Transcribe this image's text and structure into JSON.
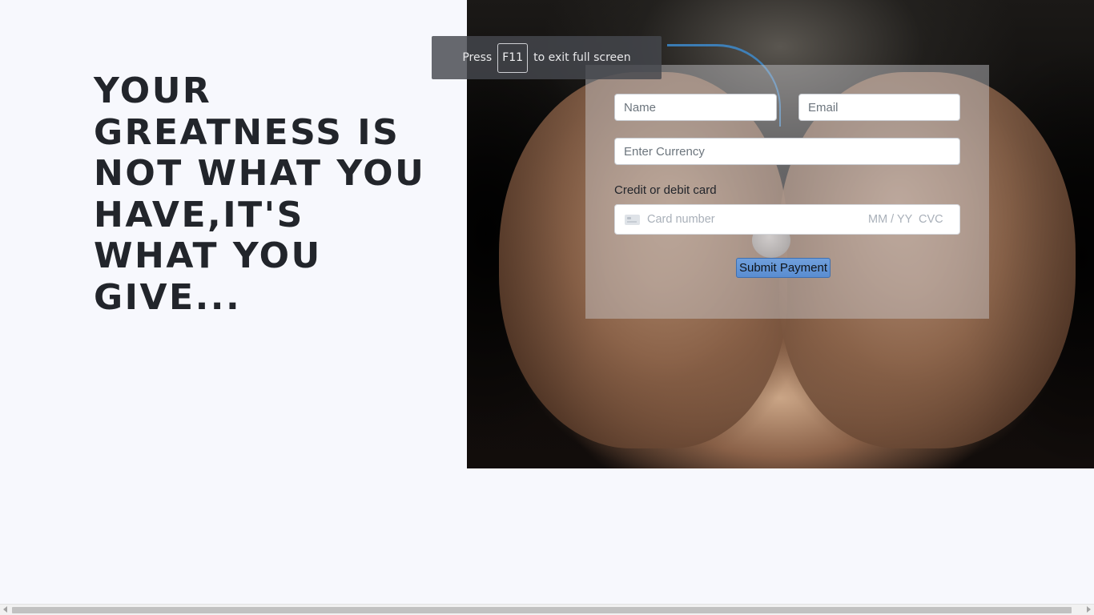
{
  "fullscreen_notice": {
    "prefix": "Press",
    "key": "F11",
    "suffix": "to exit full screen"
  },
  "hero": {
    "quote": "YOUR GREATNESS IS NOT WHAT YOU HAVE,IT'S WHAT YOU GIVE..."
  },
  "donation_form": {
    "name_placeholder": "Name",
    "email_placeholder": "Email",
    "currency_placeholder": "Enter Currency",
    "card_label": "Credit or debit card",
    "card_number_placeholder": "Card number",
    "card_expiry_placeholder": "MM / YY",
    "card_cvc_placeholder": "CVC",
    "submit_label": "Submit Payment"
  },
  "colors": {
    "page_background": "#f7f8fd",
    "quote_text": "#22252b",
    "submit_button": "#5a8dd1"
  }
}
